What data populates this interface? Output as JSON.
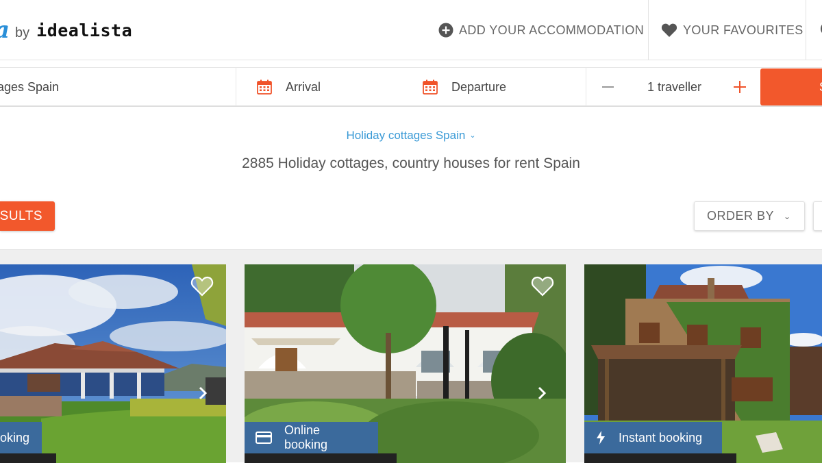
{
  "header": {
    "logo_by": "by",
    "logo_brand": "idealista",
    "add_accommodation": "ADD YOUR ACCOMMODATION",
    "your_favourites": "YOUR FAVOURITES"
  },
  "search": {
    "destination": "ages Spain",
    "arrival": "Arrival",
    "departure": "Departure",
    "travellers": "1 traveller",
    "search_button": "S"
  },
  "page": {
    "breadcrumb": "Holiday cottages Spain",
    "title": "2885 Holiday cottages, country houses for rent Spain"
  },
  "controls": {
    "results_button": "ESULTS",
    "order_by": "ORDER BY"
  },
  "listings": [
    {
      "badge": "oking",
      "badge_icon": "card-icon"
    },
    {
      "badge": "Online booking",
      "badge_icon": "card-icon"
    },
    {
      "badge": "Instant booking",
      "badge_icon": "lightning-icon"
    }
  ],
  "colors": {
    "accent": "#f2582c",
    "link": "#3a9ad6",
    "badge": "#3b6a9c",
    "logo": "#2a8fd8"
  }
}
